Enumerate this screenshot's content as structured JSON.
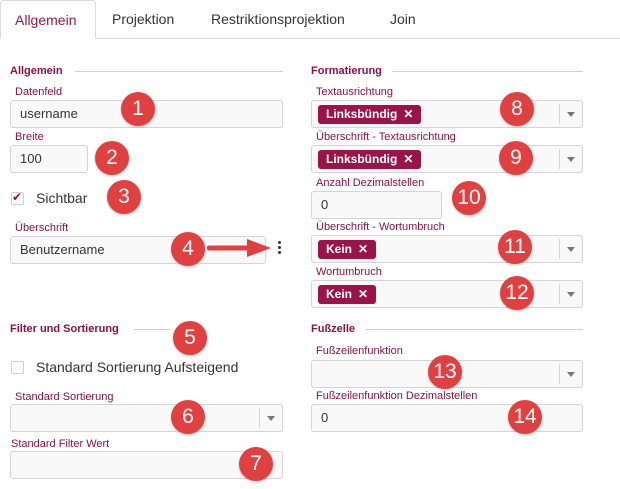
{
  "tabs": [
    "Allgemein",
    "Projektion",
    "Restriktionsprojektion",
    "Join"
  ],
  "left": {
    "section1_title": "Allgemein",
    "datenfeld_label": "Datenfeld",
    "datenfeld_value": "username",
    "breite_label": "Breite",
    "breite_value": "100",
    "sichtbar_label": "Sichtbar",
    "ueberschrift_label": "Überschrift",
    "ueberschrift_value": "Benutzername",
    "section2_title": "Filter und Sortierung",
    "std_sort_asc_label": "Standard Sortierung Aufsteigend",
    "std_sort_label": "Standard Sortierung",
    "std_filter_label": "Standard Filter Wert"
  },
  "right": {
    "section1_title": "Formatierung",
    "textausrichtung_label": "Textausrichtung",
    "textausrichtung_chip": "Linksbündig",
    "ue_textausrichtung_label": "Überschrift - Textausrichtung",
    "ue_textausrichtung_chip": "Linksbündig",
    "dezimal_label": "Anzahl Dezimalstellen",
    "dezimal_value": "0",
    "ue_wortumbruch_label": "Überschrift - Wortumbruch",
    "ue_wortumbruch_chip": "Kein",
    "wortumbruch_label": "Wortumbruch",
    "wortumbruch_chip": "Kein",
    "section2_title": "Fußzelle",
    "fuss_funktion_label": "Fußzeilenfunktion",
    "fuss_dezimal_label": "Fußzeilenfunktion Dezimalstellen",
    "fuss_dezimal_value": "0"
  },
  "chip_remove_glyph": "✕",
  "badges": [
    "1",
    "2",
    "3",
    "4",
    "5",
    "6",
    "7",
    "8",
    "9",
    "10",
    "11",
    "12",
    "13",
    "14"
  ],
  "colors": {
    "accent": "#9b1447",
    "badge": "#e04040"
  }
}
